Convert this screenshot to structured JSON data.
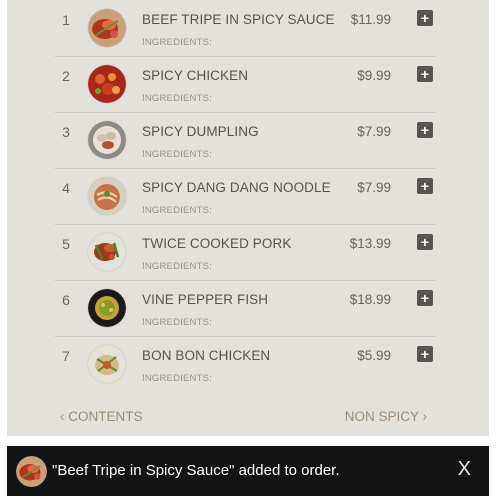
{
  "menu": {
    "items": [
      {
        "number": "1",
        "name": "BEEF TRIPE IN SPICY SAUCE",
        "ingredients_label": "INGREDIENTS:",
        "price": "$11.99",
        "add_icon": "plus-icon",
        "image": "beef-tripe-photo"
      },
      {
        "number": "2",
        "name": "SPICY CHICKEN",
        "ingredients_label": "INGREDIENTS:",
        "price": "$9.99",
        "add_icon": "plus-icon",
        "image": "spicy-chicken-photo"
      },
      {
        "number": "3",
        "name": "SPICY DUMPLING",
        "ingredients_label": "INGREDIENTS:",
        "price": "$7.99",
        "add_icon": "plus-icon",
        "image": "spicy-dumpling-photo"
      },
      {
        "number": "4",
        "name": "SPICY DANG DANG NOODLE",
        "ingredients_label": "INGREDIENTS:",
        "price": "$7.99",
        "add_icon": "plus-icon",
        "image": "dang-dang-noodle-photo"
      },
      {
        "number": "5",
        "name": "TWICE COOKED PORK",
        "ingredients_label": "INGREDIENTS:",
        "price": "$13.99",
        "add_icon": "plus-icon",
        "image": "twice-cooked-pork-photo"
      },
      {
        "number": "6",
        "name": "VINE PEPPER FISH",
        "ingredients_label": "INGREDIENTS:",
        "price": "$18.99",
        "add_icon": "plus-icon",
        "image": "vine-pepper-fish-photo"
      },
      {
        "number": "7",
        "name": "BON BON CHICKEN",
        "ingredients_label": "INGREDIENTS:",
        "price": "$5.99",
        "add_icon": "plus-icon",
        "image": "bon-bon-chicken-photo"
      }
    ]
  },
  "nav": {
    "prev_label": "‹ CONTENTS",
    "next_label": "NON SPICY ›"
  },
  "toast": {
    "message": "\"Beef Tripe in Spicy Sauce\" added to order.",
    "close_label": "X",
    "image": "beef-tripe-photo"
  },
  "colors": {
    "panel_background": "#e3e1dc",
    "item_text": "#5b5248",
    "nav_link": "#998e7c",
    "add_button": "#595551",
    "toast_background": "#141414"
  }
}
